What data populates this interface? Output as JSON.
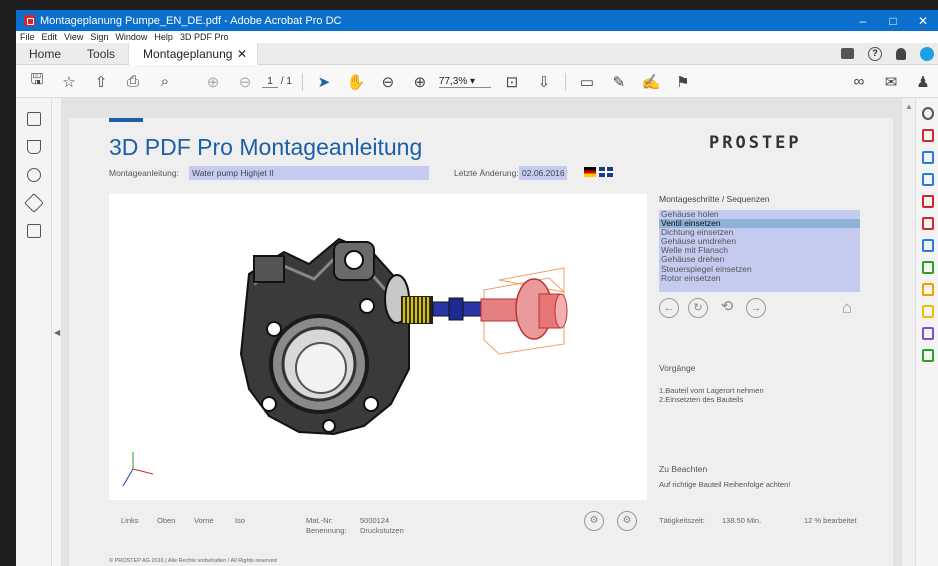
{
  "window": {
    "title": "Montageplanung Pumpe_EN_DE.pdf - Adobe Acrobat Pro DC",
    "controls": {
      "minimize": "–",
      "maximize": "□",
      "close": "✕"
    }
  },
  "menu": [
    "File",
    "Edit",
    "View",
    "Sign",
    "Window",
    "Help",
    "3D PDF Pro"
  ],
  "tabs": {
    "home": "Home",
    "tools": "Tools",
    "doc": "Montageplanung P...",
    "doc_close": "✕"
  },
  "toolbar": {
    "page_current": "1",
    "page_total": "/ 1",
    "zoom": "77,3%  ▾"
  },
  "doc": {
    "title": "3D PDF Pro  Montageanleitung",
    "logo": "PROSTEP",
    "label_montage": "Montageanleitung:",
    "value_montage": "Water pump Highjet II",
    "label_changed": "Letzte Änderung:",
    "value_changed": "02.06.2016",
    "seq_heading": "Montageschritte / Sequenzen",
    "seq_items": [
      "Gehäuse holen",
      "Ventil einsetzen",
      "Dichtung einsetzen",
      "Gehäuse umdrehen",
      "Welle mit Flansch",
      "Gehäuse drehen",
      "Steuerspiegel einsetzen",
      "Rotor einsetzen"
    ],
    "seq_selected": 1,
    "vorgaenge_heading": "Vorgänge",
    "vorgaenge_text1": "1.Bauteil vom Lagerort nehmen",
    "vorgaenge_text2": "2.Einsetzten des Bauteils",
    "beachten_heading": "Zu Beachten",
    "beachten_text": "Auf richtige Bauteil Reihenfolge achten!",
    "views": [
      "Links",
      "Oben",
      "Vorne",
      "Iso"
    ],
    "mat_label": "Mat.-Nr:",
    "mat_value": "5000124",
    "ben_label": "Benennung:",
    "ben_value": "Druckstutzen",
    "time_label": "Tätigkeitszeit:",
    "time_value": "138.50 Min.",
    "progress": "12 % bearbeitet",
    "copyright": "© PROSTEP AG 2016 | Alle Rechte vorbehalten / All Rights reserved"
  },
  "colors": {
    "titlebar": "#0b6fcd",
    "accent": "#1a5fa8",
    "field": "#c5cbee",
    "selected": "#8fb3d6",
    "logo_red": "#d4262b"
  }
}
